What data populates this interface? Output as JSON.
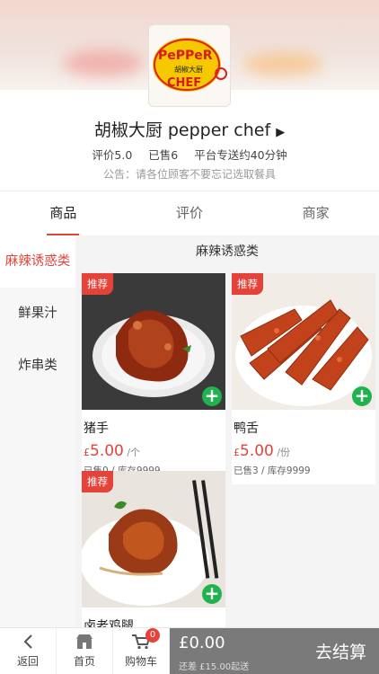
{
  "store": {
    "name": "胡椒大厨 pepper chef",
    "rating": "评价5.0",
    "sold": "已售6",
    "delivery": "平台专送约40分钟",
    "notice": "公告：请各位顾客不要忘记选取餐具",
    "logo_text_top": "PePPeR",
    "logo_text_cn": "胡椒大厨",
    "logo_text_bottom": "CHEF"
  },
  "tabs": [
    "商品",
    "评价",
    "商家"
  ],
  "categories": [
    "麻辣诱惑类",
    "鲜果汁",
    "炸串类"
  ],
  "section_title": "麻辣诱惑类",
  "products": [
    {
      "badge": "推荐",
      "name": "猪手",
      "currency": "£",
      "price": "5.00",
      "unit": " /个",
      "stock": "已售0 / 库存9999"
    },
    {
      "badge": "推荐",
      "name": "鸭舌",
      "currency": "£",
      "price": "5.00",
      "unit": " /份",
      "stock": "已售3 / 库存9999"
    },
    {
      "badge": "推荐",
      "name": "卤老鸡腿"
    }
  ],
  "bottom": {
    "back": "返回",
    "home": "首页",
    "cart": "购物车",
    "cart_count": "0",
    "total": "£0.00",
    "min_order": "还差 £15.00起送",
    "checkout": "去结算"
  },
  "colors": {
    "accent": "#e5433a",
    "add_button": "#1fb24e",
    "checkout_bg": "#7a7a7a"
  }
}
